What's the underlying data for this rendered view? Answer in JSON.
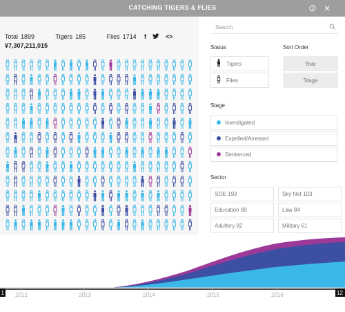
{
  "app": {
    "title": "CATCHING TIGERS & FLIES"
  },
  "titlebar": {
    "info_icon": "info-icon",
    "close_icon": "close-icon"
  },
  "stats": {
    "total_label": "Total",
    "total": "1899",
    "tigers_label": "Tigers",
    "tigers": "185",
    "flies_label": "Flies",
    "flies": "1714",
    "money": "¥7,307,211,015"
  },
  "share": {
    "facebook": "f",
    "twitter": "twitter-icon",
    "embed": "<>"
  },
  "search": {
    "placeholder": "Search"
  },
  "status": {
    "label": "Status",
    "tigers": "Tigers",
    "flies": "Flies"
  },
  "sort": {
    "label": "Sort Order",
    "year": "Year",
    "stage": "Stage"
  },
  "stage": {
    "label": "Stage",
    "items": [
      {
        "label": "Investigated",
        "color": "#3bb7e8"
      },
      {
        "label": "Expelled/Arrested",
        "color": "#3d4fa3"
      },
      {
        "label": "Sentenced",
        "color": "#9b3a99"
      }
    ]
  },
  "sector": {
    "label": "Sector",
    "cells": [
      {
        "label": "SOE 193"
      },
      {
        "label": "Sky Net 103"
      },
      {
        "label": "Education 89"
      },
      {
        "label": "Law 84"
      },
      {
        "label": "Adultery 82"
      },
      {
        "label": "Military 61"
      }
    ]
  },
  "timeline": {
    "years": [
      "2012",
      "2013",
      "2014",
      "2015",
      "2016"
    ],
    "start_marker": "1",
    "end_marker": "12"
  },
  "colors": {
    "investigated": "#3bb7e8",
    "expelled": "#3d4fa3",
    "sentenced": "#9b3a99",
    "titlebar": "#9e9e9e"
  }
}
